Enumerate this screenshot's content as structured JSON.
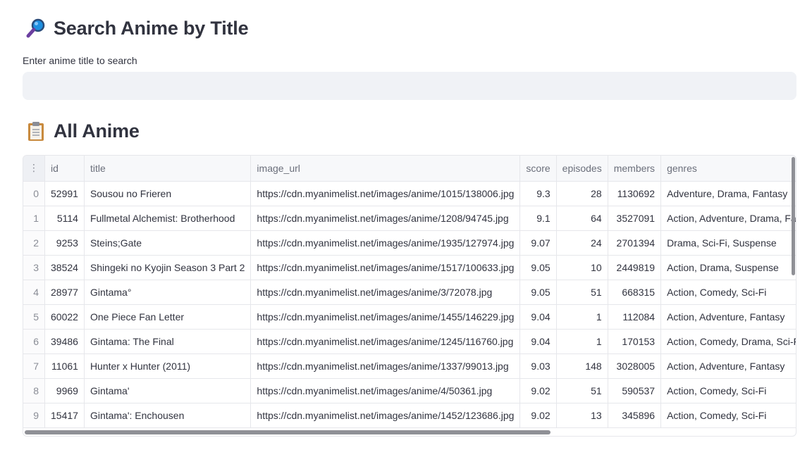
{
  "search_section": {
    "icon": "magnifying-glass-icon",
    "title": "Search Anime by Title",
    "input_label": "Enter anime title to search",
    "input_value": "",
    "input_placeholder": ""
  },
  "list_section": {
    "icon": "clipboard-icon",
    "title": "All Anime"
  },
  "table": {
    "columns": [
      "id",
      "title",
      "image_url",
      "score",
      "episodes",
      "members",
      "genres"
    ],
    "rows": [
      {
        "index": "0",
        "id": "52991",
        "title": "Sousou no Frieren",
        "image_url": "https://cdn.myanimelist.net/images/anime/1015/138006.jpg",
        "score": "9.3",
        "episodes": "28",
        "members": "1130692",
        "genres": "Adventure, Drama, Fantasy"
      },
      {
        "index": "1",
        "id": "5114",
        "title": "Fullmetal Alchemist: Brotherhood",
        "image_url": "https://cdn.myanimelist.net/images/anime/1208/94745.jpg",
        "score": "9.1",
        "episodes": "64",
        "members": "3527091",
        "genres": "Action, Adventure, Drama, Fantasy"
      },
      {
        "index": "2",
        "id": "9253",
        "title": "Steins;Gate",
        "image_url": "https://cdn.myanimelist.net/images/anime/1935/127974.jpg",
        "score": "9.07",
        "episodes": "24",
        "members": "2701394",
        "genres": "Drama, Sci-Fi, Suspense"
      },
      {
        "index": "3",
        "id": "38524",
        "title": "Shingeki no Kyojin Season 3 Part 2",
        "image_url": "https://cdn.myanimelist.net/images/anime/1517/100633.jpg",
        "score": "9.05",
        "episodes": "10",
        "members": "2449819",
        "genres": "Action, Drama, Suspense"
      },
      {
        "index": "4",
        "id": "28977",
        "title": "Gintama°",
        "image_url": "https://cdn.myanimelist.net/images/anime/3/72078.jpg",
        "score": "9.05",
        "episodes": "51",
        "members": "668315",
        "genres": "Action, Comedy, Sci-Fi"
      },
      {
        "index": "5",
        "id": "60022",
        "title": "One Piece Fan Letter",
        "image_url": "https://cdn.myanimelist.net/images/anime/1455/146229.jpg",
        "score": "9.04",
        "episodes": "1",
        "members": "112084",
        "genres": "Action, Adventure, Fantasy"
      },
      {
        "index": "6",
        "id": "39486",
        "title": "Gintama: The Final",
        "image_url": "https://cdn.myanimelist.net/images/anime/1245/116760.jpg",
        "score": "9.04",
        "episodes": "1",
        "members": "170153",
        "genres": "Action, Comedy, Drama, Sci-Fi"
      },
      {
        "index": "7",
        "id": "11061",
        "title": "Hunter x Hunter (2011)",
        "image_url": "https://cdn.myanimelist.net/images/anime/1337/99013.jpg",
        "score": "9.03",
        "episodes": "148",
        "members": "3028005",
        "genres": "Action, Adventure, Fantasy"
      },
      {
        "index": "8",
        "id": "9969",
        "title": "Gintama'",
        "image_url": "https://cdn.myanimelist.net/images/anime/4/50361.jpg",
        "score": "9.02",
        "episodes": "51",
        "members": "590537",
        "genres": "Action, Comedy, Sci-Fi"
      },
      {
        "index": "9",
        "id": "15417",
        "title": "Gintama': Enchousen",
        "image_url": "https://cdn.myanimelist.net/images/anime/1452/123686.jpg",
        "score": "9.02",
        "episodes": "13",
        "members": "345896",
        "genres": "Action, Comedy, Sci-Fi"
      }
    ]
  }
}
